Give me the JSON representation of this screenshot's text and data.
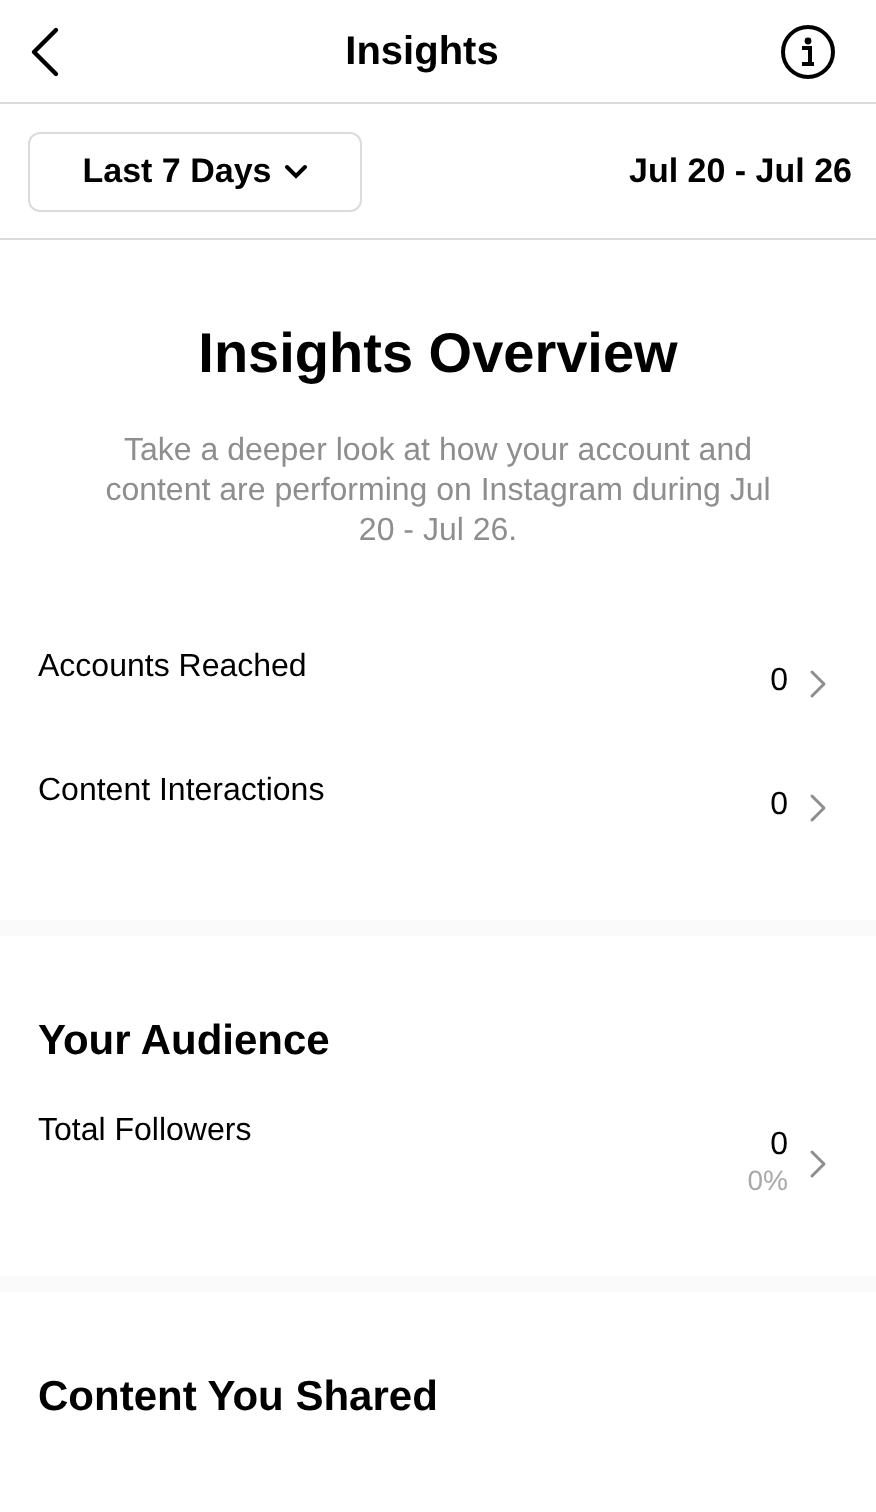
{
  "header": {
    "title": "Insights"
  },
  "filter": {
    "label": "Last 7 Days",
    "date_range": "Jul 20 - Jul 26"
  },
  "overview": {
    "title": "Insights Overview",
    "description": "Take a deeper look at how your account and content are performing on Instagram during Jul 20 - Jul 26.",
    "rows": [
      {
        "label": "Accounts Reached",
        "value": "0"
      },
      {
        "label": "Content Interactions",
        "value": "0"
      }
    ]
  },
  "audience": {
    "title": "Your Audience",
    "rows": [
      {
        "label": "Total Followers",
        "value": "0",
        "change": "0%"
      }
    ]
  },
  "content_shared": {
    "title": "Content You Shared"
  }
}
